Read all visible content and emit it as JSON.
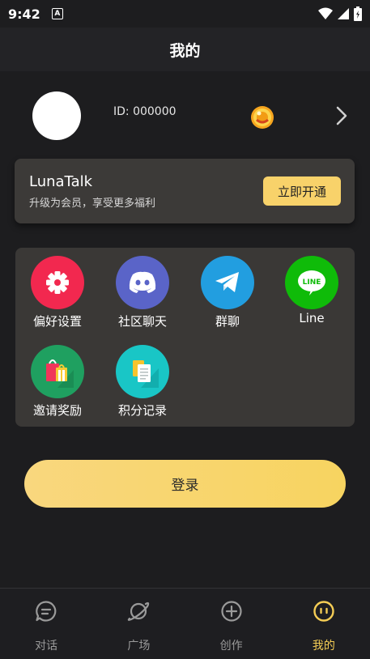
{
  "status_bar": {
    "time": "9:42",
    "a_glyph": "A"
  },
  "header": {
    "title": "我的"
  },
  "profile": {
    "id_text": "ID: 000000",
    "coin_icon": "coin-icon",
    "chevron_icon": "chevron-right-icon"
  },
  "member": {
    "brand": "LunaTalk",
    "desc": "升级为会员，享受更多福利",
    "button": "立即开通",
    "button_color": "#f8d26a"
  },
  "grid": {
    "items": [
      {
        "label": "偏好设置",
        "icon": "gear-icon",
        "color": "#f2284f"
      },
      {
        "label": "社区聊天",
        "icon": "discord-icon",
        "color": "#5a64c8"
      },
      {
        "label": "群聊",
        "icon": "telegram-icon",
        "color": "#229ee0"
      },
      {
        "label": "Line",
        "icon": "line-icon",
        "color": "#0fbb09"
      },
      {
        "label": "邀请奖励",
        "icon": "gift-bag-icon",
        "color": "#1fa060"
      },
      {
        "label": "积分记录",
        "icon": "document-icon",
        "color": "#19c6c6"
      }
    ]
  },
  "login": {
    "label": "登录"
  },
  "nav": {
    "items": [
      {
        "label": "对话",
        "icon": "chat-icon"
      },
      {
        "label": "广场",
        "icon": "planet-icon"
      },
      {
        "label": "创作",
        "icon": "plus-circle-icon"
      },
      {
        "label": "我的",
        "icon": "smiley-icon",
        "active": true
      }
    ],
    "active_color": "#f5cd55",
    "inactive_color": "#9a9a9a"
  }
}
